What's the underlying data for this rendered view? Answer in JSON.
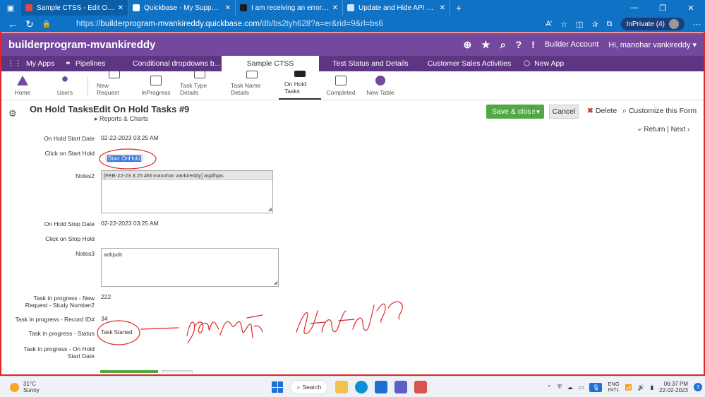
{
  "browser": {
    "tabs": [
      {
        "title": "Sample CTSS - Edit On Hold Tasks",
        "active": true,
        "favicon_color": "#e04848"
      },
      {
        "title": "Quickbase - My Support Cases",
        "active": false,
        "favicon_color": "#ffffff"
      },
      {
        "title": "I am receiving an error when attempting",
        "active": false,
        "favicon_color": "#1b1b1b"
      },
      {
        "title": "Update and Hide API Button.",
        "active": false,
        "favicon_color": "#cfe8ff"
      }
    ],
    "url_prefix": "https://",
    "url_host": "builderprogram-mvankireddy.quickbase.com",
    "url_path": "/db/bs2tyh628?a=er&rid=9&rl=bs6",
    "inprivate_label": "InPrivate (4)",
    "read_aloud_label": "A’"
  },
  "app_header": {
    "realm": "builderprogram-mvankireddy",
    "account": "Builder Account",
    "greeting": "Hi, manohar vankireddy"
  },
  "app_nav": {
    "my_apps": "My Apps",
    "pipelines": "Pipelines",
    "items": [
      "Conditional dropdowns b...",
      "Sample CTSS",
      "Test Status and Details",
      "Customer Sales Activities"
    ],
    "new_app": "New App"
  },
  "table_bar": {
    "home": "Home",
    "users": "Users",
    "tables": [
      "New Request",
      "InProgress",
      "Task Type Details",
      "Task Name Details",
      "On Hold Tasks",
      "Completed"
    ],
    "new_table": "New Table"
  },
  "form_header": {
    "table_name": "On Hold Tasks",
    "separator": ">",
    "record_title": "Edit On Hold Tasks #9",
    "reports_link": "Reports & Charts",
    "save_close": "Save & close",
    "cancel": "Cancel",
    "delete": "Delete",
    "customize": "Customize this Form",
    "return_label": "Return",
    "next_label": "Next"
  },
  "form": {
    "on_hold_start_date": {
      "label": "On Hold Start Date",
      "value": "02-22-2023 03:25 AM"
    },
    "click_start_hold": {
      "label": "Click on Start Hold",
      "button": "Start OnHold"
    },
    "notes2": {
      "label": "Notes2",
      "history": "[FEB-22-23  3:25 AM  manohar vankireddy] asjdhjas"
    },
    "on_hold_stop_date": {
      "label": "On Hold Stop Date",
      "value": "02-22-2023 03:25 AM"
    },
    "click_stop_hold": {
      "label": "Click on Stop Hold"
    },
    "notes3": {
      "label": "Notes3",
      "value": "adhjsdh"
    },
    "study_number": {
      "label_line1": "Task in progress - New",
      "label_line2": "Request - Study Number2",
      "value": "222"
    },
    "record_id": {
      "label": "Task in progress - Record ID#",
      "value": "34"
    },
    "status": {
      "label": "Task in progress - Status",
      "value": "Task Started"
    },
    "on_hold_start": {
      "label_line1": "Task in progress - On Hold",
      "label_line2": "Start Date"
    }
  },
  "taskbar": {
    "temperature": "31°C",
    "condition": "Sunny",
    "search": "Search",
    "lang1": "ENG",
    "lang2": "INTL",
    "time": "06:37 PM",
    "date": "22-02-2023",
    "notifications": "3"
  },
  "colors": {
    "brand_purple": "#74489d",
    "nav_purple": "#5e3582",
    "save_green": "#52a844",
    "annotation_red": "#e0262b",
    "browser_blue": "#0f72c5"
  }
}
